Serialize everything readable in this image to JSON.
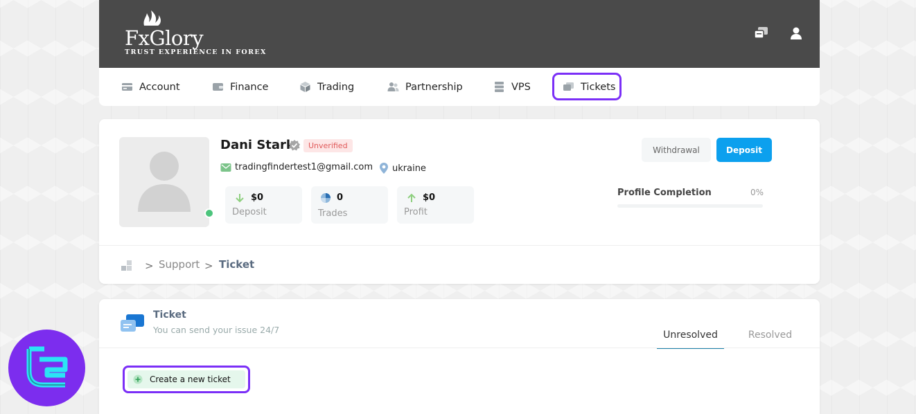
{
  "header": {
    "brand": "FxGlory",
    "tagline": "TRUST EXPERIENCE IN FOREX"
  },
  "nav": {
    "items": [
      {
        "label": "Account",
        "icon": "account-icon"
      },
      {
        "label": "Finance",
        "icon": "wallet-icon"
      },
      {
        "label": "Trading",
        "icon": "cube-icon"
      },
      {
        "label": "Partnership",
        "icon": "people-icon"
      },
      {
        "label": "VPS",
        "icon": "server-icon"
      },
      {
        "label": "Tickets",
        "icon": "tickets-icon"
      }
    ],
    "highlight_color": "#7b2ff7"
  },
  "profile": {
    "name": "Dani Stark",
    "status_badge": "Unverified",
    "email": "tradingfindertest1@gmail.com",
    "location": "ukraine",
    "stats": [
      {
        "value": "$0",
        "label": "Deposit"
      },
      {
        "value": "0",
        "label": "Trades"
      },
      {
        "value": "$0",
        "label": "Profit"
      }
    ],
    "withdrawal_label": "Withdrawal",
    "deposit_label": "Deposit",
    "profile_completion_label": "Profile Completion",
    "profile_completion_value": "0%",
    "profile_completion_fraction": 0
  },
  "breadcrumb": {
    "sep": ">",
    "support": "Support",
    "current": "Ticket"
  },
  "ticket_panel": {
    "title": "Ticket",
    "subtitle": "You can send your issue 24/7",
    "tabs": [
      "Unresolved",
      "Resolved"
    ],
    "active_tab": "Unresolved",
    "create_label": "Create a new ticket"
  },
  "colors": {
    "header_bg": "#4a4a4a",
    "deposit_button": "#0ca0ee",
    "online": "#4cc47c",
    "badge_bg": "#fde6e6",
    "badge_text": "#e05a5a",
    "watermark": "#7c2dee"
  }
}
